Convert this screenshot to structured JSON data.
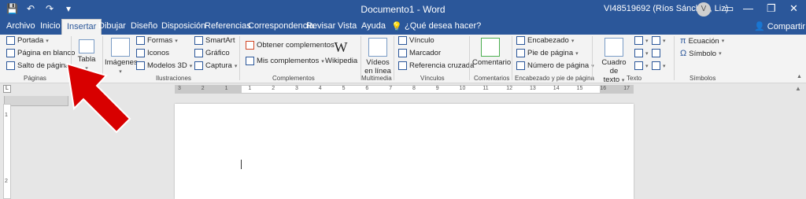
{
  "window": {
    "title": "Documento1 - Word",
    "user": "VI48519692 (Ríos Sánchez, Liz)",
    "avatar_letter": "V",
    "minimize": "—",
    "restore": "❐",
    "close": "✕"
  },
  "qat": {
    "save": "💾",
    "undo": "↶",
    "redo": "↷",
    "more": "▾"
  },
  "tabs": [
    "Archivo",
    "Inicio",
    "Insertar",
    "Dibujar",
    "Diseño",
    "Disposición",
    "Referencias",
    "Correspondencia",
    "Revisar",
    "Vista",
    "Ayuda"
  ],
  "active_tab": "Insertar",
  "tell_me": "¿Qué desea hacer?",
  "share": "Compartir",
  "groups": {
    "paginas": {
      "label": "Páginas",
      "portada": "Portada",
      "pagina_en_blanco": "Página en blanco",
      "salto_de_pagina": "Salto de página"
    },
    "tablas": {
      "tabla": "Tabla"
    },
    "ilustraciones": {
      "label": "Ilustraciones",
      "imagenes": "Imágenes",
      "formas": "Formas",
      "iconos": "Iconos",
      "modelos3d": "Modelos 3D",
      "smartart": "SmartArt",
      "grafico": "Gráfico",
      "captura": "Captura"
    },
    "complementos": {
      "label": "Complementos",
      "obtener": "Obtener complementos",
      "mis": "Mis complementos",
      "wikipedia": "Wikipedia",
      "w_glyph": "W"
    },
    "multimedia": {
      "label": "Multimedia",
      "videos": "Vídeos",
      "en_linea": "en línea"
    },
    "vinculos": {
      "label": "Vínculos",
      "vinculo": "Vínculo",
      "marcador": "Marcador",
      "referencia": "Referencia cruzada"
    },
    "comentarios": {
      "label": "Comentarios",
      "comentario": "Comentario"
    },
    "encabezado": {
      "label": "Encabezado y pie de página",
      "encabezado": "Encabezado",
      "pie": "Pie de página",
      "numero": "Número de página"
    },
    "texto": {
      "label": "Texto",
      "cuadro": "Cuadro de",
      "texto": "texto"
    },
    "simbolos": {
      "label": "Símbolos",
      "ecuacion": "Ecuación",
      "simbolo": "Símbolo",
      "pi_glyph": "π",
      "omega_glyph": "Ω"
    }
  },
  "ruler_ticks": [
    "3",
    "2",
    "1",
    "1",
    "2",
    "3",
    "4",
    "5",
    "6",
    "7",
    "8",
    "9",
    "10",
    "11",
    "12",
    "13",
    "14",
    "15",
    "16",
    "17"
  ],
  "vruler_ticks": [
    "1",
    "2"
  ],
  "colors": {
    "brand": "#2b579a",
    "arrow": "#d80000"
  }
}
